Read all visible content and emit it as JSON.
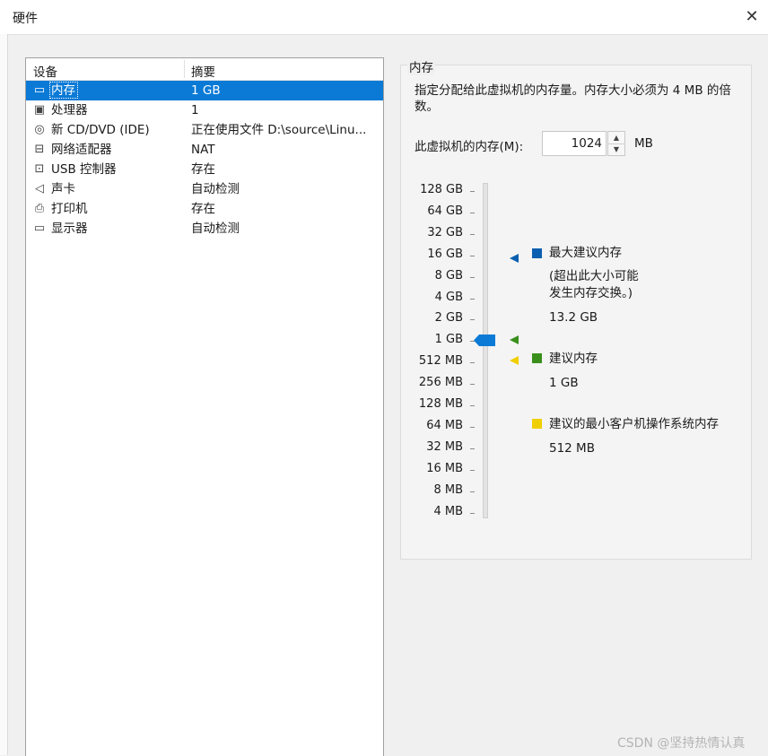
{
  "window": {
    "title": "硬件",
    "close_icon": "close-icon"
  },
  "devices": {
    "header": {
      "device": "设备",
      "summary": "摘要"
    },
    "items": [
      {
        "icon": "memory-icon",
        "name": "内存",
        "summary": "1 GB",
        "selected": true
      },
      {
        "icon": "cpu-icon",
        "name": "处理器",
        "summary": "1",
        "selected": false
      },
      {
        "icon": "disc-icon",
        "name": "新 CD/DVD (IDE)",
        "summary": "正在使用文件 D:\\source\\Linu...",
        "selected": false
      },
      {
        "icon": "network-icon",
        "name": "网络适配器",
        "summary": "NAT",
        "selected": false
      },
      {
        "icon": "usb-icon",
        "name": "USB 控制器",
        "summary": "存在",
        "selected": false
      },
      {
        "icon": "speaker-icon",
        "name": "声卡",
        "summary": "自动检测",
        "selected": false
      },
      {
        "icon": "printer-icon",
        "name": "打印机",
        "summary": "存在",
        "selected": false
      },
      {
        "icon": "monitor-icon",
        "name": "显示器",
        "summary": "自动检测",
        "selected": false
      }
    ]
  },
  "memory": {
    "group_title": "内存",
    "description": "指定分配给此虚拟机的内存量。内存大小必须为 4 MB 的倍数。",
    "field_label": "此虚拟机的内存(M):",
    "value": "1024",
    "unit": "MB",
    "scale": [
      "128 GB",
      "64 GB",
      "32 GB",
      "16 GB",
      "8 GB",
      "4 GB",
      "2 GB",
      "1 GB",
      "512 MB",
      "256 MB",
      "128 MB",
      "64 MB",
      "32 MB",
      "16 MB",
      "8 MB",
      "4 MB"
    ],
    "legend": {
      "max": {
        "color": "#0b5fb0",
        "label": "最大建议内存",
        "note1": "(超出此大小可能",
        "note2": "发生内存交换。)",
        "value": "13.2 GB"
      },
      "recommended": {
        "color": "#3a8f1c",
        "label": "建议内存",
        "value": "1 GB"
      },
      "min": {
        "color": "#f0cf00",
        "label": "建议的最小客户机操作系统内存",
        "value": "512 MB"
      }
    },
    "slider_color": "#0a7ad6"
  },
  "watermark": "CSDN @坚持热情认真"
}
